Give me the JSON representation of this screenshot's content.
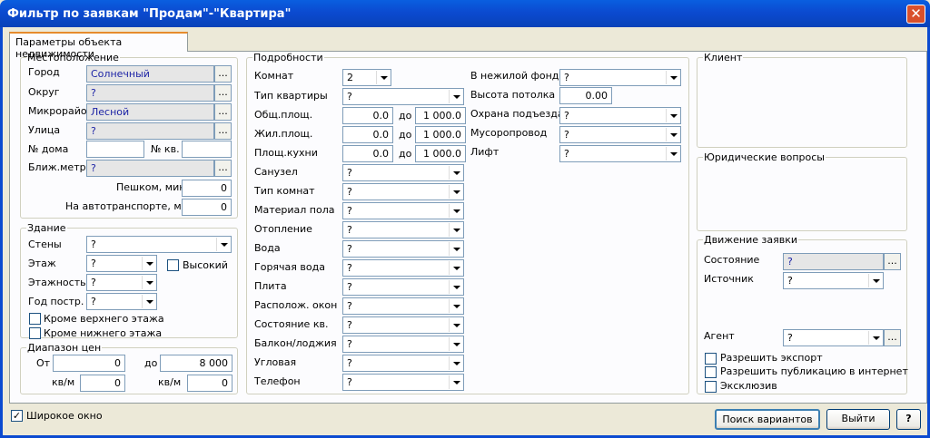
{
  "window": {
    "title": "Фильтр по заявкам \"Продам\"-\"Квартира\"",
    "close_glyph": "✕"
  },
  "tab": {
    "label": "Параметры объекта недвижимости"
  },
  "location": {
    "legend": "Местоположение",
    "city_label": "Город",
    "city_value": "Солнечный",
    "district_label": "Округ",
    "district_value": "?",
    "microdistrict_label": "Микрорайон",
    "microdistrict_value": "Лесной",
    "street_label": "Улица",
    "street_value": "?",
    "house_label": "№ дома",
    "house_value": "",
    "apt_label": "№ кв.",
    "apt_value": "",
    "metro_label": "Ближ.метро",
    "metro_value": "?",
    "walk_label": "Пешком, мин",
    "walk_value": "0",
    "transport_label": "На автотранспорте, мин",
    "transport_value": "0",
    "ellipsis": "..."
  },
  "building": {
    "legend": "Здание",
    "walls_label": "Стены",
    "walls_value": "?",
    "floor_label": "Этаж",
    "floor_value": "?",
    "high_label": "Высокий",
    "high_checked": false,
    "floors_label": "Этажность",
    "floors_value": "?",
    "year_label": "Год постр.",
    "year_value": "?",
    "except_top_label": "Кроме верхнего этажа",
    "except_top_checked": false,
    "except_bottom_label": "Кроме нижнего этажа",
    "except_bottom_checked": false
  },
  "price": {
    "legend": "Диапазон цен",
    "from_label": "От",
    "from_value": "0",
    "to_label": "до",
    "to_value": "8 000",
    "sqm_from_label": "кв/м",
    "sqm_from_value": "0",
    "sqm_to_label": "кв/м",
    "sqm_to_value": "0"
  },
  "details": {
    "legend": "Подробности",
    "rooms_label": "Комнат",
    "rooms_value": "2",
    "type_label": "Тип квартиры",
    "type_value": "?",
    "total_area_label": "Общ.площ.",
    "total_area_from": "0.0",
    "total_area_to": "1 000.0",
    "living_area_label": "Жил.площ.",
    "living_area_from": "0.0",
    "living_area_to": "1 000.0",
    "kitchen_area_label": "Площ.кухни",
    "kitchen_area_from": "0.0",
    "kitchen_area_to": "1 000.0",
    "to_label": "до",
    "rows": [
      {
        "label": "Санузел",
        "value": "?"
      },
      {
        "label": "Тип комнат",
        "value": "?"
      },
      {
        "label": "Материал пола",
        "value": "?"
      },
      {
        "label": "Отопление",
        "value": "?"
      },
      {
        "label": "Вода",
        "value": "?"
      },
      {
        "label": "Горячая вода",
        "value": "?"
      },
      {
        "label": "Плита",
        "value": "?"
      },
      {
        "label": "Располож. окон",
        "value": "?"
      },
      {
        "label": "Состояние кв.",
        "value": "?"
      },
      {
        "label": "Балкон/лоджия",
        "value": "?"
      },
      {
        "label": "Угловая",
        "value": "?"
      },
      {
        "label": "Телефон",
        "value": "?"
      }
    ],
    "nonres_label": "В нежилой фонд",
    "nonres_value": "?",
    "ceiling_label": "Высота потолка",
    "ceiling_value": "0.00",
    "security_label": "Охрана подъезда",
    "security_value": "?",
    "garbage_label": "Мусоропровод",
    "garbage_value": "?",
    "lift_label": "Лифт",
    "lift_value": "?"
  },
  "client": {
    "legend": "Клиент"
  },
  "legal": {
    "legend": "Юридические вопросы"
  },
  "movement": {
    "legend": "Движение заявки",
    "state_label": "Состояние",
    "state_value": "?",
    "source_label": "Источник",
    "source_value": "?",
    "agent_label": "Агент",
    "agent_value": "?",
    "export_label": "Разрешить экспорт",
    "export_checked": false,
    "publish_label": "Разрешить публикацию в интернет",
    "publish_checked": false,
    "exclusive_label": "Эксклюзив",
    "exclusive_checked": false
  },
  "footer": {
    "wide_label": "Широкое окно",
    "wide_checked": true,
    "check_glyph": "✓",
    "search_button": "Поиск вариантов",
    "exit_button": "Выйти",
    "help_button": "?"
  }
}
